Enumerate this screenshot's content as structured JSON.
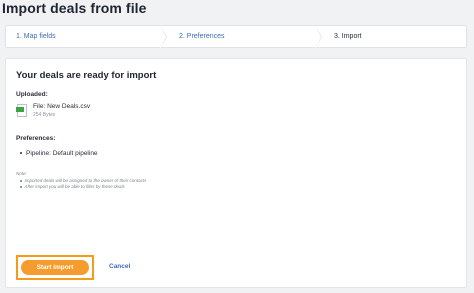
{
  "page": {
    "title": "Import deals from file"
  },
  "stepper": {
    "steps": [
      {
        "label": "1. Map fields"
      },
      {
        "label": "2. Preferences"
      },
      {
        "label": "3. Import"
      }
    ],
    "active_index": 2
  },
  "card": {
    "title": "Your deals are ready for import",
    "uploaded_label": "Uploaded:",
    "file": {
      "name": "File: New Deals.csv",
      "size": "254 Bytes",
      "icon": "csv-file-icon"
    },
    "preferences_label": "Preferences:",
    "preferences": [
      "Pipeline: Default pipeline"
    ],
    "note_label": "Note:",
    "notes": [
      "Imported deals will be assigned to the owner of their contacts",
      "After import you will be able to filter by these deals"
    ]
  },
  "actions": {
    "start_label": "Start import",
    "cancel_label": "Cancel"
  },
  "colors": {
    "accent": "#f69c2f",
    "highlight": "#f49b1c",
    "link": "#3b6fb6",
    "file_icon": "#3fa244"
  }
}
